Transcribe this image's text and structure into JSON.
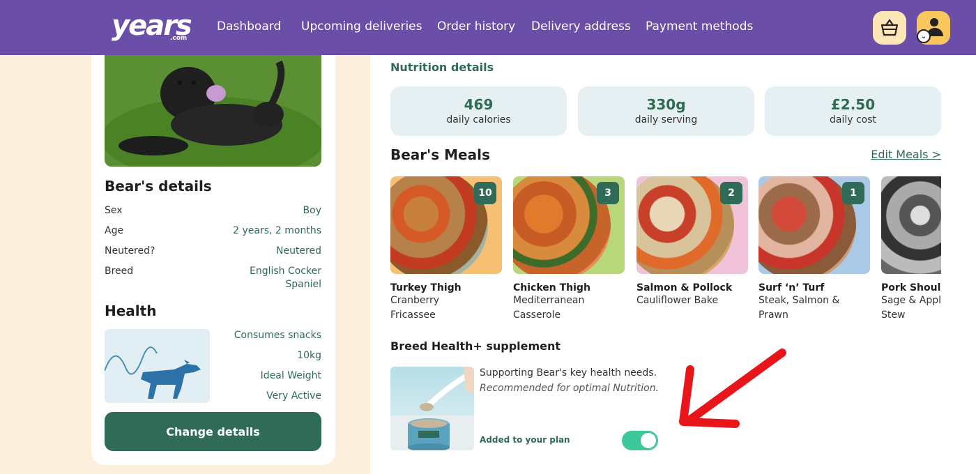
{
  "nav": {
    "logo_text": "years",
    "logo_sub": ".com",
    "items": [
      "Dashboard",
      "Upcoming deliveries",
      "Order history",
      "Delivery address",
      "Payment methods"
    ]
  },
  "pet": {
    "details_title": "Bear's details",
    "details": [
      {
        "key": "Sex",
        "value": "Boy"
      },
      {
        "key": "Age",
        "value": "2 years, 2 months"
      },
      {
        "key": "Neutered?",
        "value": "Neutered"
      },
      {
        "key": "Breed",
        "value_line1": "English Cocker",
        "value_line2": "Spaniel"
      }
    ],
    "health_title": "Health",
    "health": [
      "Consumes snacks",
      "10kg",
      "Ideal Weight",
      "Very Active"
    ],
    "change_button": "Change details"
  },
  "nutrition": {
    "title": "Nutrition details",
    "stats": [
      {
        "value": "469",
        "label": "daily calories"
      },
      {
        "value": "330g",
        "label": "daily serving"
      },
      {
        "value": "£2.50",
        "label": "daily cost"
      }
    ]
  },
  "meals": {
    "title": "Bear's Meals",
    "edit_link": "Edit Meals >",
    "items": [
      {
        "count": "10",
        "name": "Turkey Thigh",
        "desc1": "Cranberry",
        "desc2": "Fricassee",
        "bg": "#f5c074"
      },
      {
        "count": "3",
        "name": "Chicken Thigh",
        "desc1": "Mediterranean",
        "desc2": "Casserole",
        "bg": "#b8d67a"
      },
      {
        "count": "2",
        "name": "Salmon & Pollock",
        "desc1": "Cauliflower Bake",
        "desc2": "",
        "bg": "#f0c3d8"
      },
      {
        "count": "1",
        "name": "Surf ‘n’ Turf",
        "desc1": "Steak, Salmon &",
        "desc2": "Prawn",
        "bg": "#a9c9e6"
      },
      {
        "count": "",
        "name": "Pork Shoulder",
        "desc1": "Sage & Apple",
        "desc2": "Stew",
        "bg": "#888888"
      }
    ]
  },
  "supplement": {
    "title": "Breed Health+ supplement",
    "line1": "Supporting Bear's key health needs.",
    "line2": "Recommended for optimal Nutrition.",
    "added_label": "Added to your plan",
    "toggle_on": true
  },
  "colors": {
    "brand_purple": "#6a4ea8",
    "accent_green": "#2e6b51",
    "toggle_green": "#3ec79a",
    "annotation_red": "#e8151b"
  }
}
